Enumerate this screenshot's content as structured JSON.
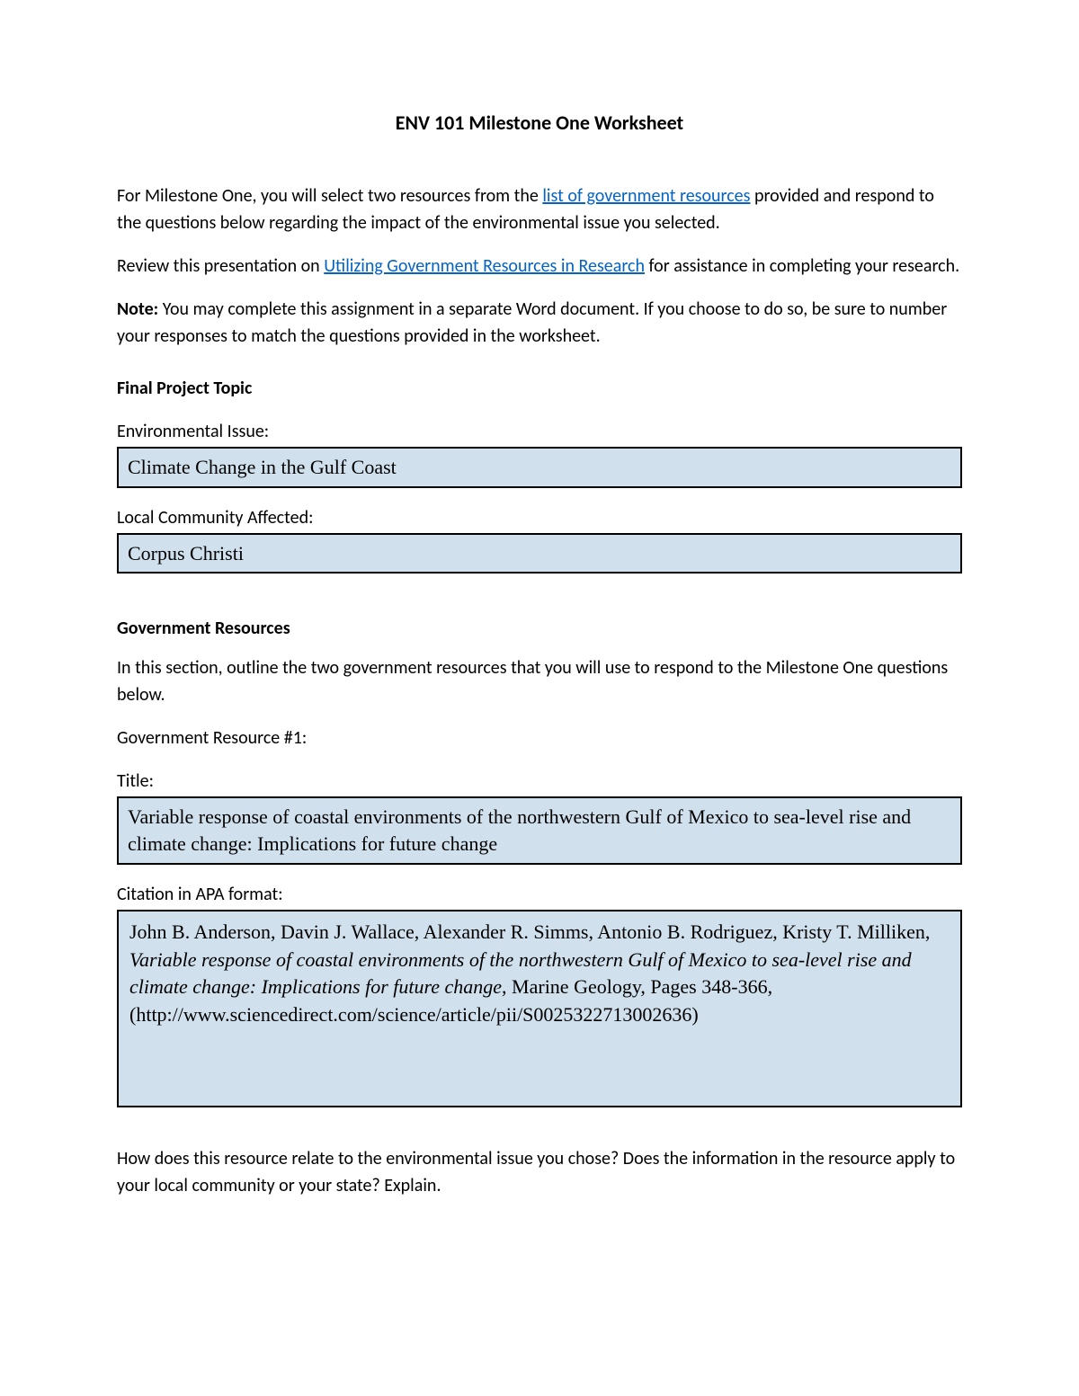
{
  "title": "ENV 101 Milestone One Worksheet",
  "intro": {
    "part1": "For Milestone One, you will select two resources from the ",
    "link1": "list of government resources",
    "part2": " provided and respond to the questions below regarding the impact of the environmental issue you selected."
  },
  "review": {
    "part1": "Review this presentation on ",
    "link1": "Utilizing Government Resources in Research",
    "part2": " for assistance in completing your research."
  },
  "note": {
    "label": "Note:",
    "text": " You may complete this assignment in a separate Word document. If you choose to do so, be sure to number your responses to match the questions provided in the worksheet."
  },
  "finalProject": {
    "header": "Final Project Topic",
    "envIssueLabel": "Environmental Issue:",
    "envIssueValue": "Climate Change in the Gulf Coast",
    "communityLabel": "Local Community Affected:",
    "communityValue": "Corpus Christi"
  },
  "govResources": {
    "header": "Government Resources",
    "intro": "In this section, outline the two government resources that you will use to respond to the Milestone One questions below.",
    "resource1Label": "Government Resource #1:",
    "titleLabel": "Title:",
    "titleValue": "Variable response of coastal environments of the northwestern Gulf of Mexico to sea-level rise and climate change: Implications for future change",
    "citationLabel": "Citation in APA format:",
    "citation": {
      "authors": "John B. Anderson, Davin J. Wallace, Alexander R. Simms, Antonio B. Rodriguez, Kristy T. Milliken, ",
      "italicTitle": "Variable response of coastal environments of the northwestern Gulf of Mexico to sea-level rise and climate change: Implications for future change",
      "rest": ", Marine Geology, Pages 348-366, (http://www.sciencedirect.com/science/article/pii/S0025322713002636)"
    }
  },
  "question": "How does this resource relate to the environmental issue you chose? Does the information in the resource apply to your local community or your state? Explain."
}
